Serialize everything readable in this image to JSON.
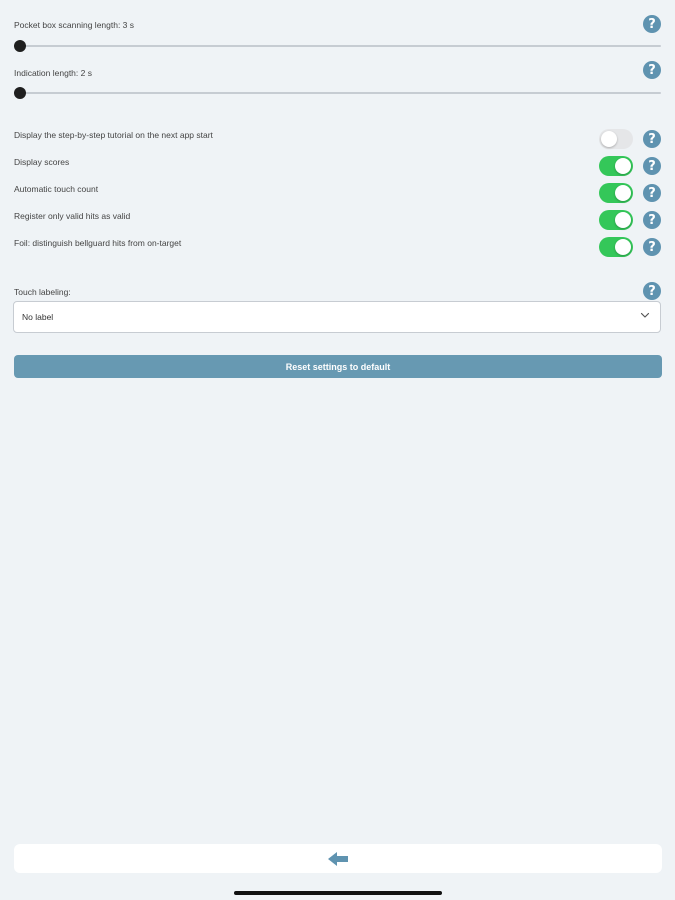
{
  "sliders": [
    {
      "label": "Pocket box scanning length: 3 s",
      "value": 0
    },
    {
      "label": "Indication length: 2 s",
      "value": 0
    }
  ],
  "toggles": [
    {
      "label": "Display the step-by-step tutorial on the next app start",
      "on": false
    },
    {
      "label": "Display scores",
      "on": true
    },
    {
      "label": "Automatic touch count",
      "on": true
    },
    {
      "label": "Register only valid hits as valid",
      "on": true
    },
    {
      "label": "Foil: distinguish bellguard hits from on-target",
      "on": true
    }
  ],
  "touch_labeling": {
    "label": "Touch labeling:",
    "selected": "No label"
  },
  "reset_button": "Reset settings to default",
  "help_glyph": "?",
  "icons": {
    "help": "help-icon",
    "back": "back-arrow-icon",
    "dropdown": "chevron-down-icon"
  },
  "colors": {
    "background": "#eff3f6",
    "accent": "#6799b2",
    "help": "#5f93b0",
    "toggle_on": "#34c759",
    "toggle_off": "#e5e6e8"
  }
}
